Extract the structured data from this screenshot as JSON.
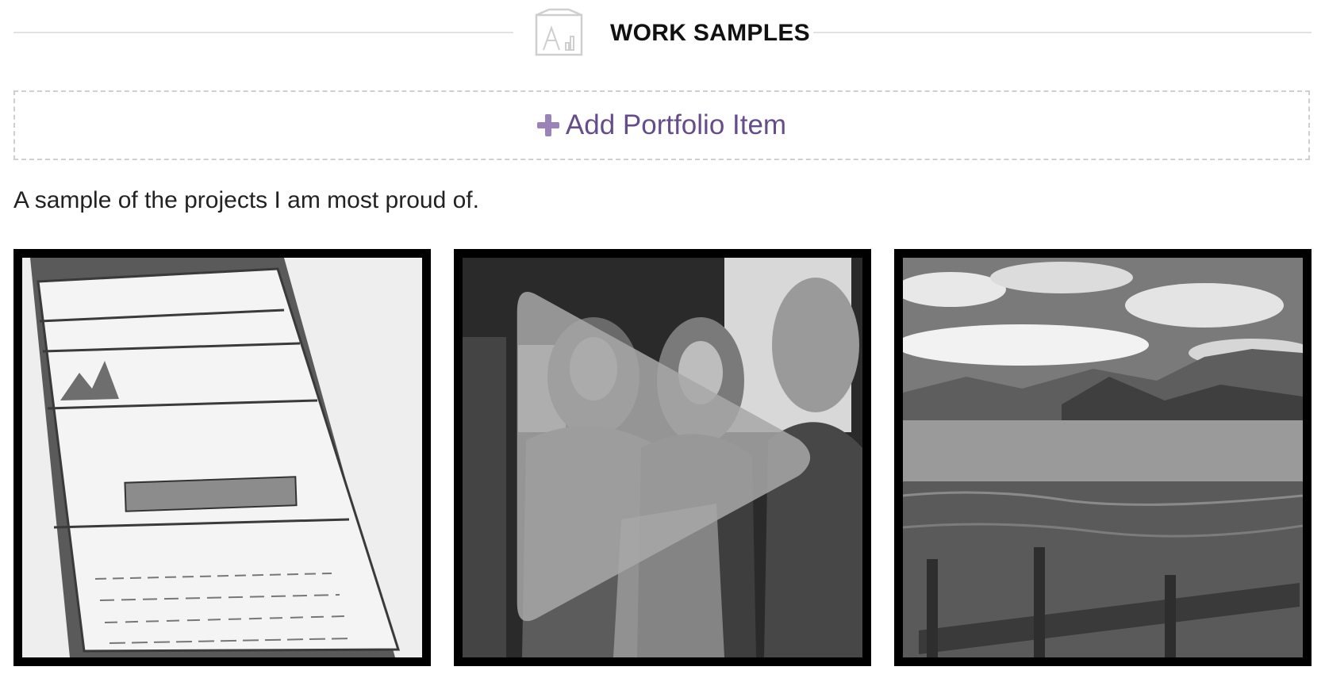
{
  "section": {
    "title": "WORK SAMPLES",
    "icon": "easel-chart-icon"
  },
  "add_item": {
    "label": "Add Portfolio Item",
    "icon": "plus-icon",
    "accent_color": "#654d8c",
    "icon_color": "#9983b9"
  },
  "description": "A sample of the projects I am most proud of.",
  "portfolio": {
    "items": [
      {
        "kind": "image",
        "subject": "phone wireframe sketch"
      },
      {
        "kind": "video",
        "subject": "panel discussion",
        "icon": "play-icon"
      },
      {
        "kind": "image",
        "subject": "mountain lake landscape"
      }
    ]
  }
}
